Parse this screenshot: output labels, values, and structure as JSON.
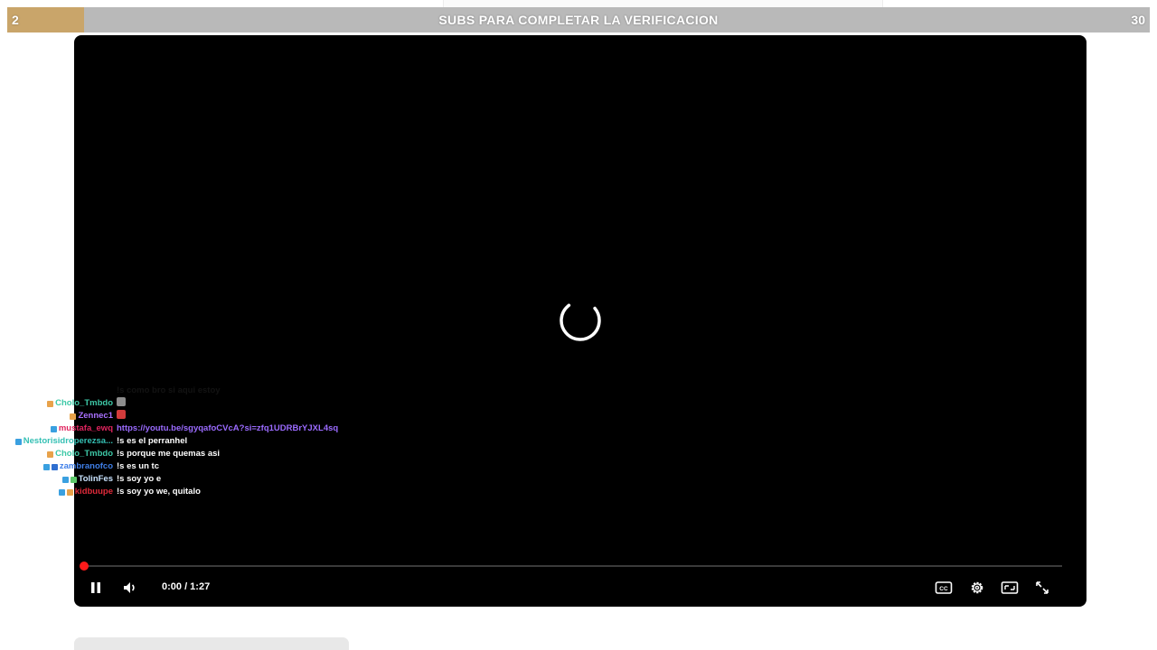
{
  "goal_bar": {
    "start_value": "2",
    "end_value": "30",
    "title": "SUBS PARA COMPLETAR LA VERIFICACION",
    "progress_fraction": 0.067,
    "fill_color": "#c9a56a",
    "track_color": "#b9b9b9"
  },
  "player": {
    "state": "loading",
    "time_display": "0:00 / 1:27",
    "progress_fraction": 0.0,
    "progress_color": "#e00000",
    "controls": [
      {
        "name": "pause-icon"
      },
      {
        "name": "volume-icon"
      },
      {
        "name": "captions-icon"
      },
      {
        "name": "settings-gear-icon"
      },
      {
        "name": "theater-mode-icon"
      },
      {
        "name": "fullscreen-icon"
      }
    ]
  },
  "chat": {
    "messages": [
      {
        "user": "",
        "text": "!s como bro si aqui estoy",
        "user_color": "#9aa",
        "faded": true,
        "badges": []
      },
      {
        "user": "Cholo_Tmbdo",
        "text": "",
        "user_color": "#3ec9a7",
        "badges": [
          "#e8a24a"
        ],
        "emotes": [
          "#8d8d8d"
        ]
      },
      {
        "user": "Zennec1",
        "text": "",
        "user_color": "#a970ff",
        "badges": [
          "#e8a24a"
        ],
        "emotes": [
          "#d23b3b"
        ]
      },
      {
        "user": "mustafa_ewq",
        "text": "https://youtu.be/sgyqafoCVcA?si=zfq1UDRBrYJXL4sq",
        "user_color": "#e0245e",
        "text_color": "#9b6bff",
        "badges": [
          "#3aa0e0"
        ]
      },
      {
        "user": "Nestorisidroperezsa...",
        "text": "!s es el perranhel",
        "user_color": "#35c0b4",
        "badges": [
          "#3aa0e0"
        ]
      },
      {
        "user": "Cholo_Tmbdo",
        "text": "!s porque me quemas asi",
        "user_color": "#3ec9a7",
        "badges": [
          "#e8a24a"
        ]
      },
      {
        "user": "zambranofco",
        "text": "!s es un tc",
        "user_color": "#3f7fe8",
        "badges": [
          "#3aa0e0",
          "#2f6fd0"
        ]
      },
      {
        "user": "TolinFes",
        "text": "!s soy yo e",
        "user_color": "#c9e3ff",
        "badges": [
          "#3aa0e0",
          "#5cc96a"
        ]
      },
      {
        "user": "kidbuupe",
        "text": "!s soy yo we, quitalo",
        "user_color": "#e02a3a",
        "badges": [
          "#3aa0e0",
          "#e8a24a"
        ]
      }
    ]
  }
}
